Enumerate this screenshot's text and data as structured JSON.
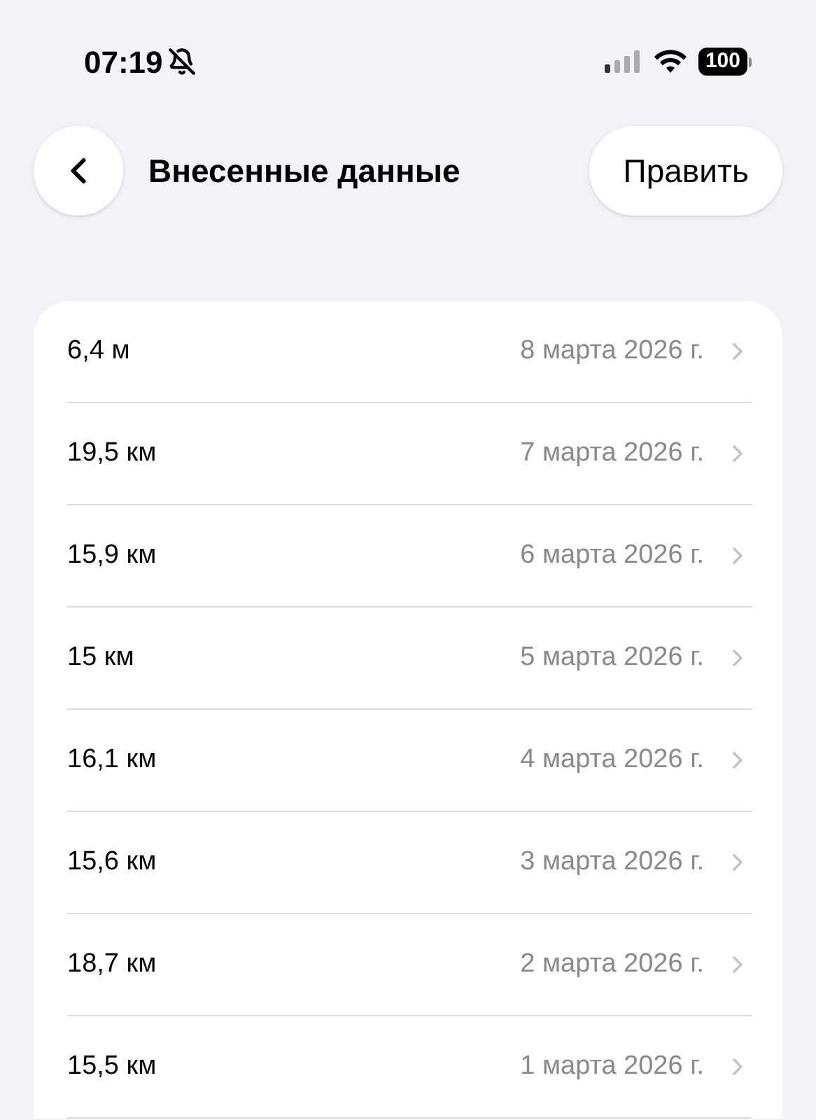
{
  "status_bar": {
    "time": "07:19",
    "battery": "100"
  },
  "nav": {
    "title": "Внесенные данные",
    "edit_button": "Править"
  },
  "entries": [
    {
      "value": "6,4 м",
      "date": "8 марта 2026 г."
    },
    {
      "value": "19,5 км",
      "date": "7 марта 2026 г."
    },
    {
      "value": "15,9 км",
      "date": "6 марта 2026 г."
    },
    {
      "value": "15 км",
      "date": "5 марта 2026 г."
    },
    {
      "value": "16,1 км",
      "date": "4 марта 2026 г."
    },
    {
      "value": "15,6 км",
      "date": "3 марта 2026 г."
    },
    {
      "value": "18,7 км",
      "date": "2 марта 2026 г."
    },
    {
      "value": "15,5 км",
      "date": "1 марта 2026 г."
    }
  ]
}
